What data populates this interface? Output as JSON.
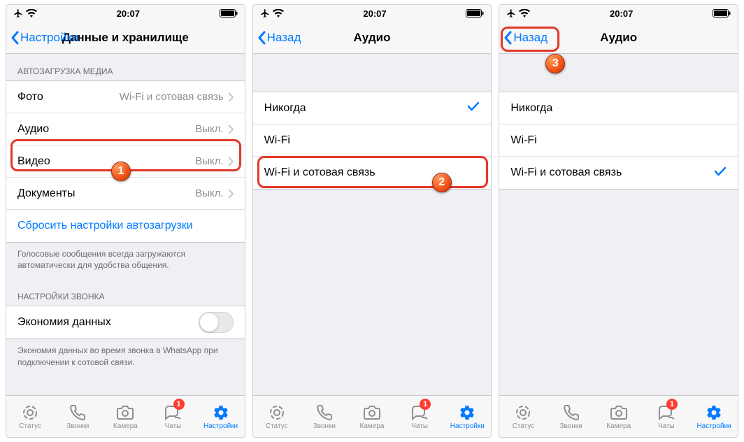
{
  "status": {
    "time": "20:07"
  },
  "tabs": {
    "status": "Статус",
    "calls": "Звонки",
    "camera": "Камера",
    "chats": "Чаты",
    "settings": "Настройки",
    "chats_badge": "1"
  },
  "screen1": {
    "back": "Настройки",
    "title": "Данные и хранилище",
    "section_media": "АВТОЗАГРУЗКА МЕДИА",
    "rows": {
      "photo": {
        "label": "Фото",
        "value": "Wi-Fi и сотовая связь"
      },
      "audio": {
        "label": "Аудио",
        "value": "Выкл."
      },
      "video": {
        "label": "Видео",
        "value": "Выкл."
      },
      "docs": {
        "label": "Документы",
        "value": "Выкл."
      }
    },
    "reset": "Сбросить настройки автозагрузки",
    "footer1": "Голосовые сообщения всегда загружаются автоматически для удобства общения.",
    "section_call": "НАСТРОЙКИ ЗВОНКА",
    "data_saver": "Экономия данных",
    "footer2": "Экономия данных во время звонка в WhatsApp при подключении к сотовой связи."
  },
  "screen2": {
    "back": "Назад",
    "title": "Аудио",
    "options": {
      "never": "Никогда",
      "wifi": "Wi-Fi",
      "wifi_cell": "Wi-Fi и сотовая связь"
    },
    "selected": "never"
  },
  "screen3": {
    "back": "Назад",
    "title": "Аудио",
    "options": {
      "never": "Никогда",
      "wifi": "Wi-Fi",
      "wifi_cell": "Wi-Fi и сотовая связь"
    },
    "selected": "wifi_cell"
  },
  "badges": {
    "b1": "1",
    "b2": "2",
    "b3": "3"
  }
}
